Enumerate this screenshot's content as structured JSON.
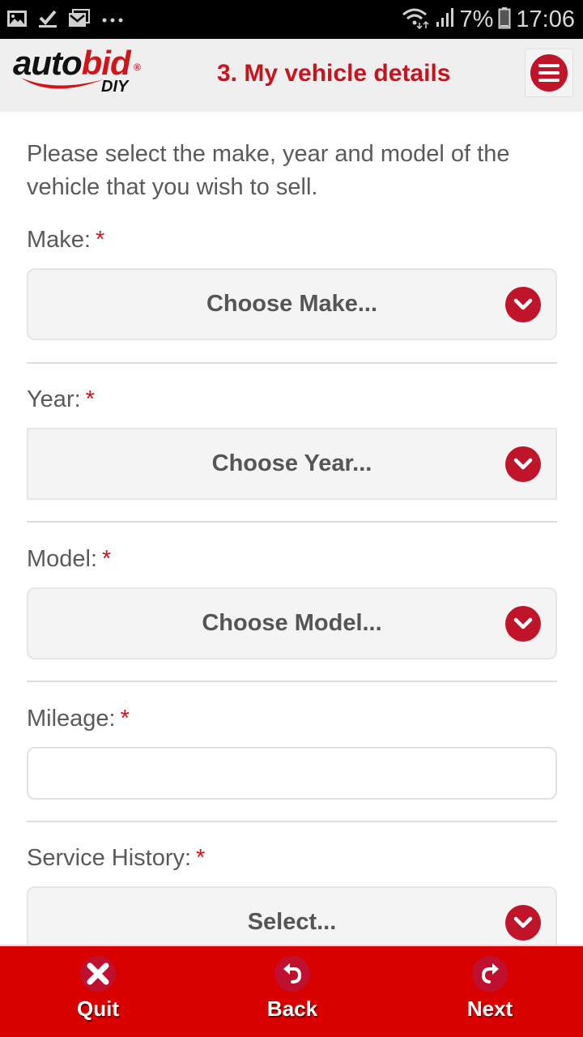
{
  "status_bar": {
    "left_icons": [
      "gallery-icon",
      "task-done-icon",
      "email-icon",
      "more-dots-icon"
    ],
    "right_icons": [
      "wifi-icon",
      "signal-icon",
      "battery-icon"
    ],
    "battery_pct": "7%",
    "time": "17:06"
  },
  "header": {
    "logo": {
      "part1": "auto",
      "part2": "bid",
      "reg": "®",
      "sub": "DIY"
    },
    "title": "3. My vehicle details",
    "menu_icon": "hamburger-menu-icon"
  },
  "form": {
    "intro": "Please select the make, year and model of the vehicle that you wish to sell.",
    "required_mark": "*",
    "fields": [
      {
        "label": "Make:",
        "type": "select",
        "value": "Choose Make..."
      },
      {
        "label": "Year:",
        "type": "select",
        "value": "Choose Year..."
      },
      {
        "label": "Model:",
        "type": "select",
        "value": "Choose Model..."
      },
      {
        "label": "Mileage:",
        "type": "text",
        "value": "",
        "placeholder": ""
      },
      {
        "label": "Service History:",
        "type": "select",
        "value": "Select..."
      }
    ]
  },
  "bottom_nav": [
    {
      "label": "Quit",
      "icon": "close-icon"
    },
    {
      "label": "Back",
      "icon": "undo-arrow-icon"
    },
    {
      "label": "Next",
      "icon": "redo-arrow-icon"
    }
  ],
  "colors": {
    "brand_red": "#d0141a",
    "icon_red": "#c0142a",
    "bottom_bar": "#d90000",
    "header_bg": "#efefef"
  }
}
